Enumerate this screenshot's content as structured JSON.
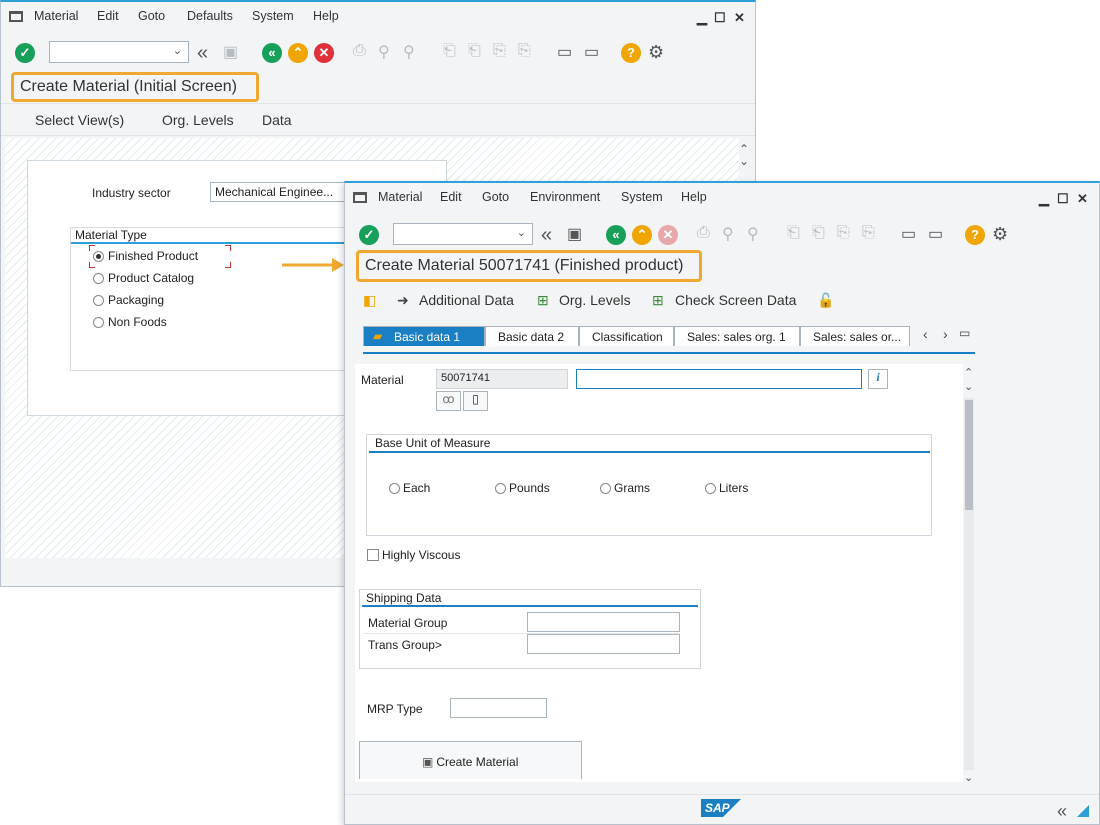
{
  "window1": {
    "menu": [
      "Material",
      "Edit",
      "Goto",
      "Defaults",
      "System",
      "Help"
    ],
    "title": "Create Material (Initial Screen)",
    "app_buttons": [
      "Select View(s)",
      "Org. Levels",
      "Data"
    ],
    "industry_sector_label": "Industry sector",
    "industry_sector_value": "Mechanical Enginee...",
    "material_type_label": "Material Type",
    "material_types": [
      "Finished Product",
      "Product Catalog",
      "Packaging",
      "Non Foods"
    ],
    "selected_type": "Finished Product"
  },
  "window2": {
    "menu": [
      "Material",
      "Edit",
      "Goto",
      "Environment",
      "System",
      "Help"
    ],
    "title": "Create Material 50071741 (Finished product)",
    "app_buttons": [
      "Additional Data",
      "Org. Levels",
      "Check Screen Data"
    ],
    "tabs": [
      "Basic data 1",
      "Basic data 2",
      "Classification",
      "Sales: sales org. 1",
      "Sales: sales or..."
    ],
    "active_tab": "Basic data 1",
    "material_label": "Material",
    "material_number": "50071741",
    "material_desc": "",
    "base_unit_label": "Base Unit of Measure",
    "units": [
      "Each",
      "Pounds",
      "Grams",
      "Liters"
    ],
    "highly_viscous_label": "Highly Viscous",
    "shipping_label": "Shipping Data",
    "material_group_label": "Material Group",
    "trans_group_label": "Trans Group>",
    "mrp_type_label": "MRP Type",
    "create_button": "Create Material",
    "logo": "SAP"
  },
  "colors": {
    "accent": "#2b9fd6",
    "highlight": "#f0a830",
    "tab_active": "#1b7fc4"
  }
}
